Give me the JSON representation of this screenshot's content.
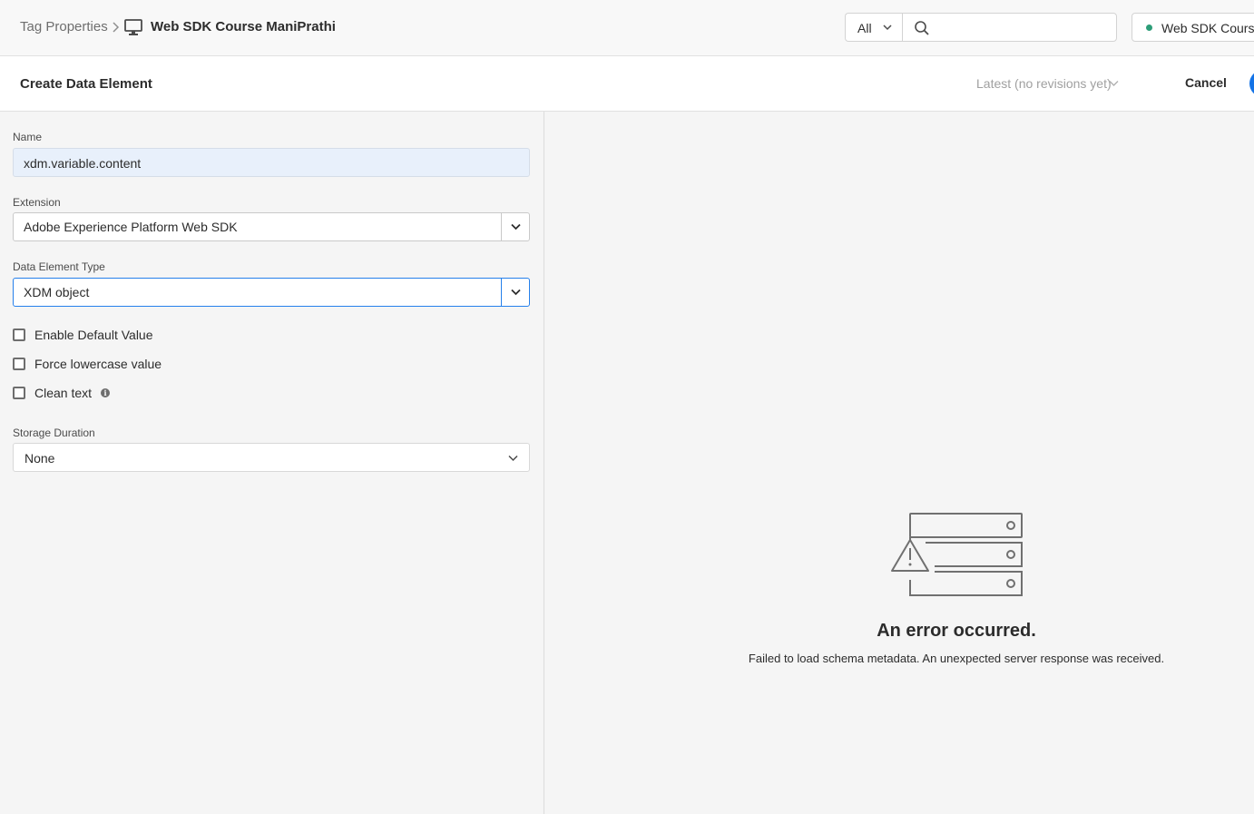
{
  "topbar": {
    "breadcrumb_root": "Tag Properties",
    "breadcrumb_current": "Web SDK Course ManiPrathi",
    "scope_filter": "All",
    "search_placeholder": "",
    "environment_label": "Web SDK Course ManiPrathi",
    "environment_status_color": "#2d9d78"
  },
  "header": {
    "title": "Create Data Element",
    "revision": "Latest (no revisions yet)",
    "cancel_label": "Cancel",
    "accent_color": "#1473e6"
  },
  "form": {
    "name_label": "Name",
    "name_value": "xdm.variable.content",
    "extension_label": "Extension",
    "extension_value": "Adobe Experience Platform Web SDK",
    "type_label": "Data Element Type",
    "type_value": "XDM object",
    "checkboxes": [
      {
        "label": "Enable Default Value",
        "checked": false
      },
      {
        "label": "Force lowercase value",
        "checked": false
      },
      {
        "label": "Clean text",
        "checked": false
      }
    ],
    "storage_label": "Storage Duration",
    "storage_value": "None"
  },
  "error": {
    "title": "An error occurred.",
    "message": "Failed to load schema metadata. An unexpected server response was received.",
    "icon": "server-warning-icon"
  }
}
